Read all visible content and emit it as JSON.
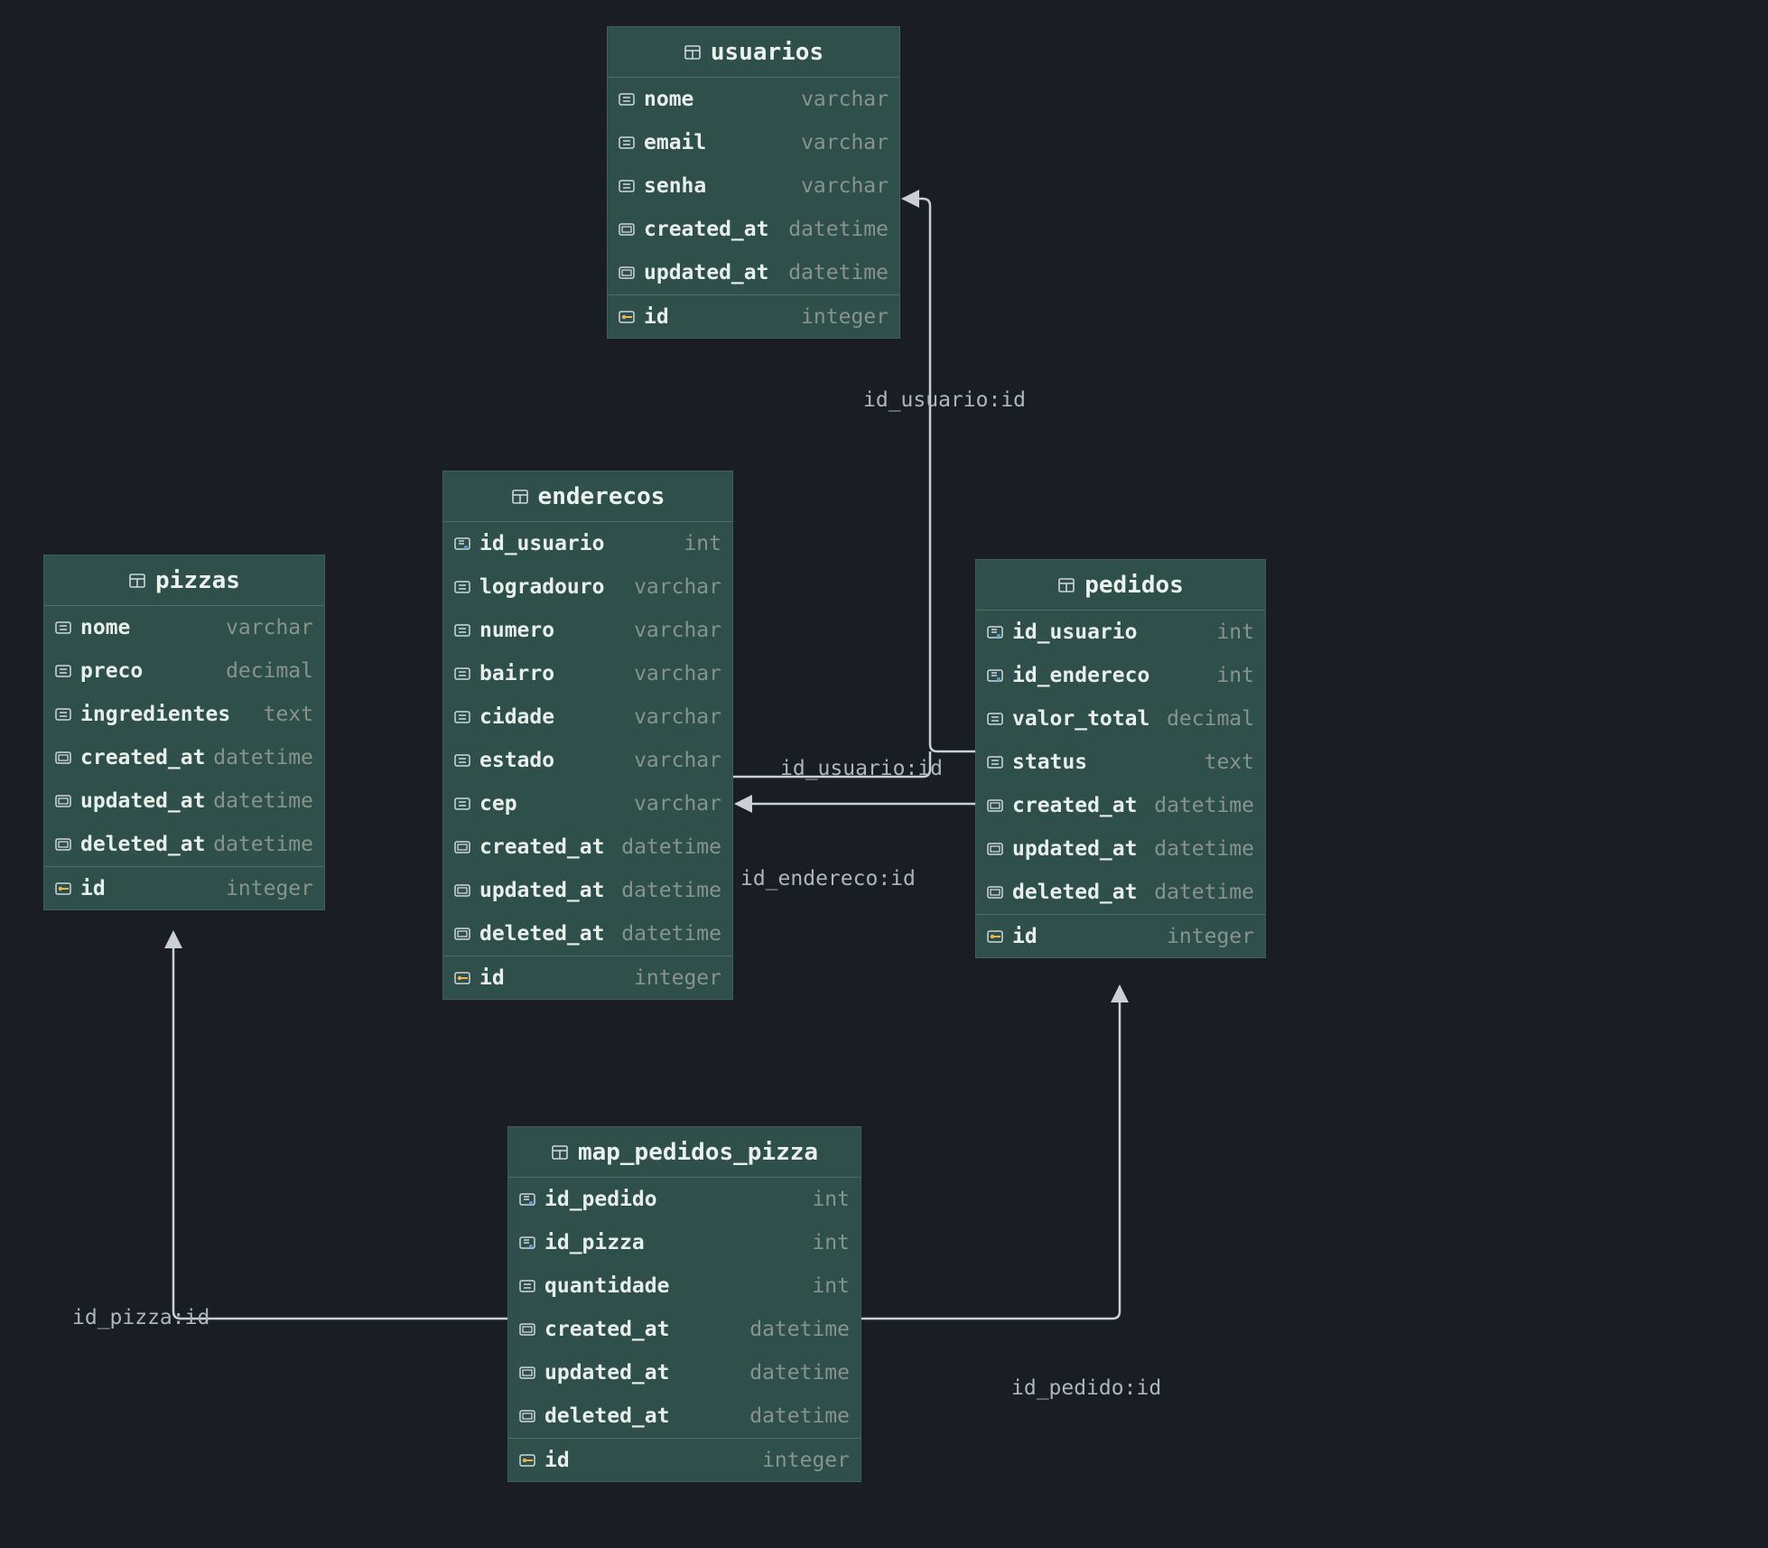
{
  "tables": {
    "usuarios": {
      "title": "usuarios",
      "rows": [
        {
          "name": "nome",
          "type": "varchar",
          "icon": "col",
          "key": false
        },
        {
          "name": "email",
          "type": "varchar",
          "icon": "col",
          "key": false
        },
        {
          "name": "senha",
          "type": "varchar",
          "icon": "col",
          "key": false
        },
        {
          "name": "created_at",
          "type": "datetime",
          "icon": "ts",
          "key": false
        },
        {
          "name": "updated_at",
          "type": "datetime",
          "icon": "ts",
          "key": false
        }
      ],
      "pk": {
        "name": "id",
        "type": "integer"
      }
    },
    "enderecos": {
      "title": "enderecos",
      "rows": [
        {
          "name": "id_usuario",
          "type": "int",
          "icon": "fk",
          "key": false
        },
        {
          "name": "logradouro",
          "type": "varchar",
          "icon": "col",
          "key": false
        },
        {
          "name": "numero",
          "type": "varchar",
          "icon": "col",
          "key": false
        },
        {
          "name": "bairro",
          "type": "varchar",
          "icon": "col",
          "key": false
        },
        {
          "name": "cidade",
          "type": "varchar",
          "icon": "col",
          "key": false
        },
        {
          "name": "estado",
          "type": "varchar",
          "icon": "col",
          "key": false
        },
        {
          "name": "cep",
          "type": "varchar",
          "icon": "col",
          "key": false
        },
        {
          "name": "created_at",
          "type": "datetime",
          "icon": "ts",
          "key": false
        },
        {
          "name": "updated_at",
          "type": "datetime",
          "icon": "ts",
          "key": false
        },
        {
          "name": "deleted_at",
          "type": "datetime",
          "icon": "ts",
          "key": false
        }
      ],
      "pk": {
        "name": "id",
        "type": "integer"
      }
    },
    "pizzas": {
      "title": "pizzas",
      "rows": [
        {
          "name": "nome",
          "type": "varchar",
          "icon": "col",
          "key": false
        },
        {
          "name": "preco",
          "type": "decimal",
          "icon": "col",
          "key": false
        },
        {
          "name": "ingredientes",
          "type": "text",
          "icon": "col",
          "key": false
        },
        {
          "name": "created_at",
          "type": "datetime",
          "icon": "ts",
          "key": false
        },
        {
          "name": "updated_at",
          "type": "datetime",
          "icon": "ts",
          "key": false
        },
        {
          "name": "deleted_at",
          "type": "datetime",
          "icon": "ts",
          "key": false
        }
      ],
      "pk": {
        "name": "id",
        "type": "integer"
      }
    },
    "pedidos": {
      "title": "pedidos",
      "rows": [
        {
          "name": "id_usuario",
          "type": "int",
          "icon": "fk",
          "key": false
        },
        {
          "name": "id_endereco",
          "type": "int",
          "icon": "fk",
          "key": false
        },
        {
          "name": "valor_total",
          "type": "decimal",
          "icon": "col",
          "key": false
        },
        {
          "name": "status",
          "type": "text",
          "icon": "col",
          "key": false
        },
        {
          "name": "created_at",
          "type": "datetime",
          "icon": "ts",
          "key": false
        },
        {
          "name": "updated_at",
          "type": "datetime",
          "icon": "ts",
          "key": false
        },
        {
          "name": "deleted_at",
          "type": "datetime",
          "icon": "ts",
          "key": false
        }
      ],
      "pk": {
        "name": "id",
        "type": "integer"
      }
    },
    "map_pedidos_pizza": {
      "title": "map_pedidos_pizza",
      "rows": [
        {
          "name": "id_pedido",
          "type": "int",
          "icon": "fk",
          "key": false
        },
        {
          "name": "id_pizza",
          "type": "int",
          "icon": "fk",
          "key": false
        },
        {
          "name": "quantidade",
          "type": "int",
          "icon": "col",
          "key": false
        },
        {
          "name": "created_at",
          "type": "datetime",
          "icon": "ts",
          "key": false
        },
        {
          "name": "updated_at",
          "type": "datetime",
          "icon": "ts",
          "key": false
        },
        {
          "name": "deleted_at",
          "type": "datetime",
          "icon": "ts",
          "key": false
        }
      ],
      "pk": {
        "name": "id",
        "type": "integer"
      }
    }
  },
  "labels": {
    "rel_usuario_enderecos": "id_usuario:id",
    "rel_usuario_pedidos": "id_usuario:id",
    "rel_endereco_pedidos": "id_endereco:id",
    "rel_pizza_map": "id_pizza:id",
    "rel_pedido_map": "id_pedido:id"
  }
}
